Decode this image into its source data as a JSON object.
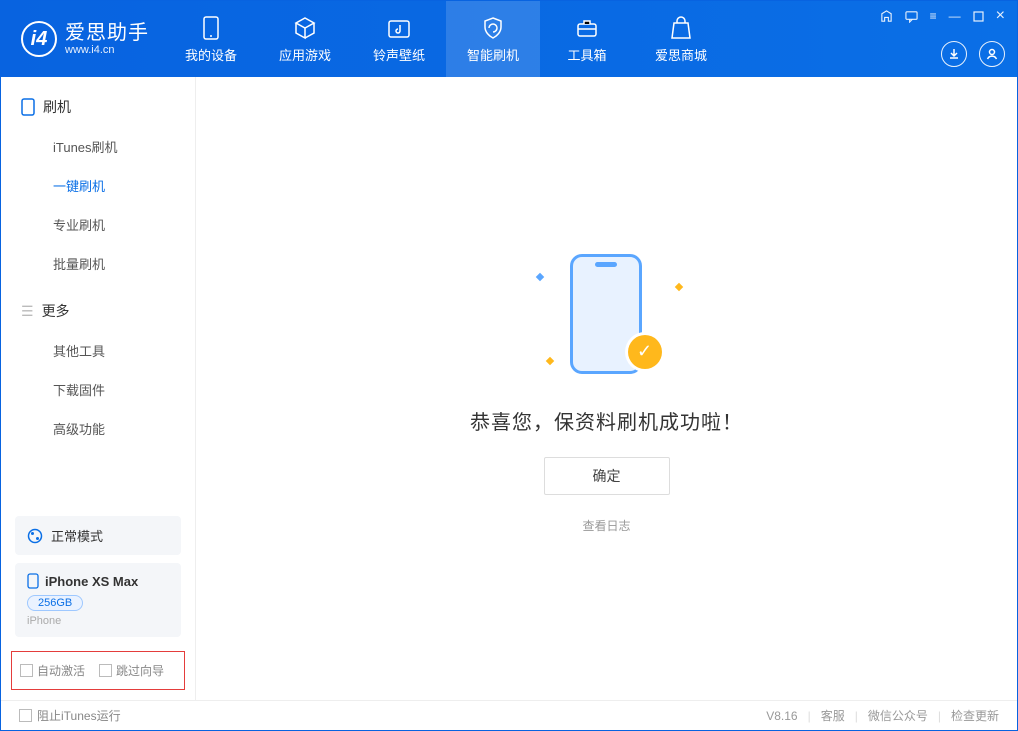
{
  "app": {
    "title": "爱思助手",
    "subtitle": "www.i4.cn"
  },
  "nav": {
    "items": [
      {
        "label": "我的设备"
      },
      {
        "label": "应用游戏"
      },
      {
        "label": "铃声壁纸"
      },
      {
        "label": "智能刷机"
      },
      {
        "label": "工具箱"
      },
      {
        "label": "爱思商城"
      }
    ]
  },
  "sidebar": {
    "section1": {
      "title": "刷机",
      "items": [
        "iTunes刷机",
        "一键刷机",
        "专业刷机",
        "批量刷机"
      ]
    },
    "section2": {
      "title": "更多",
      "items": [
        "其他工具",
        "下载固件",
        "高级功能"
      ]
    },
    "status": "正常模式",
    "device": {
      "name": "iPhone XS Max",
      "capacity": "256GB",
      "type": "iPhone"
    },
    "checks": {
      "auto_activate": "自动激活",
      "skip_guide": "跳过向导"
    }
  },
  "main": {
    "message": "恭喜您，保资料刷机成功啦！",
    "ok": "确定",
    "view_log": "查看日志"
  },
  "footer": {
    "block_itunes": "阻止iTunes运行",
    "version": "V8.16",
    "links": [
      "客服",
      "微信公众号",
      "检查更新"
    ]
  }
}
